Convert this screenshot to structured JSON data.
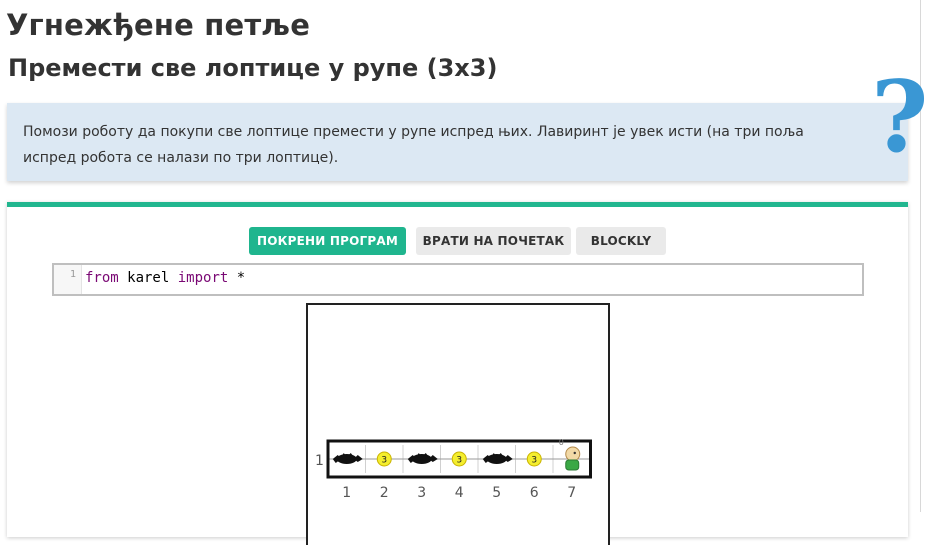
{
  "page": {
    "title": "Угнежђене петље",
    "subtitle": "Премести све лоптице у рупе (3x3)"
  },
  "note": {
    "text": "Помози роботу да покупи све лоптице премести у рупе испред њих. Лавиринт је увек исти (на три поља испред робота се налази по три лоптице).",
    "help_glyph": "?"
  },
  "toolbar": {
    "run_label": "ПОКРЕНИ ПРОГРАМ",
    "reset_label": "ВРАТИ НА ПОЧЕТАК",
    "blockly_label": "BLOCKLY"
  },
  "editor": {
    "line_number": "1",
    "code": {
      "kw1": "from",
      "mod": " karel ",
      "kw2": "import",
      "rest": " *"
    }
  },
  "world": {
    "row_label": "1",
    "columns": [
      "1",
      "2",
      "3",
      "4",
      "5",
      "6",
      "7"
    ],
    "cells": [
      {
        "type": "hole"
      },
      {
        "type": "ball",
        "count": "3"
      },
      {
        "type": "hole"
      },
      {
        "type": "ball",
        "count": "3"
      },
      {
        "type": "hole"
      },
      {
        "type": "ball",
        "count": "3"
      },
      {
        "type": "robot",
        "label": "0"
      }
    ],
    "colors": {
      "ball": "#f4ee2e",
      "hole": "#111111",
      "robot_shirt": "#3aa845",
      "wall": "#111111"
    },
    "icons": {
      "ball": "ball-icon",
      "hole": "hole-icon",
      "robot": "robot-icon"
    }
  },
  "colors": {
    "accent": "#1fb58e",
    "note_bg": "#dce8f3",
    "help": "#3a97d4"
  }
}
